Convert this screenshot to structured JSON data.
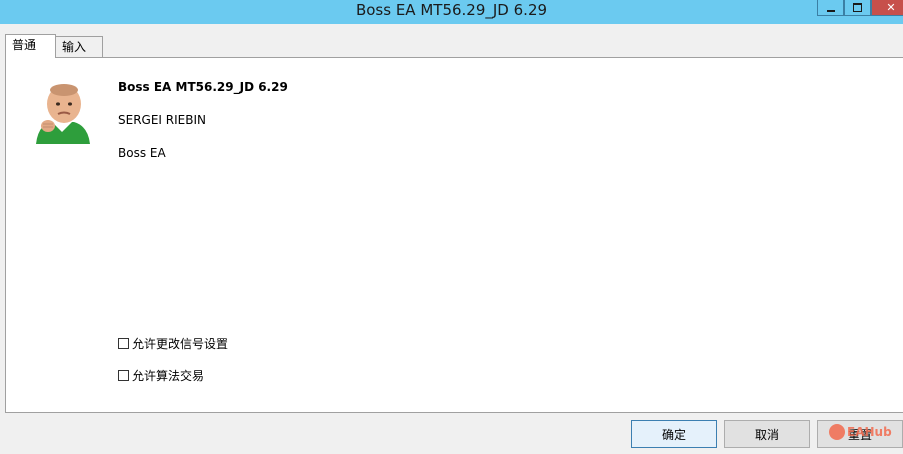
{
  "window": {
    "title": "Boss EA MT56.29_JD 6.29"
  },
  "tabs": [
    {
      "label": "普通"
    },
    {
      "label": "输入"
    }
  ],
  "general": {
    "ea_name": "Boss EA MT56.29_JD 6.29",
    "author": "SERGEI RIEBIN",
    "description": "Boss EA",
    "checkboxes": [
      {
        "label": "允许更改信号设置",
        "checked": false
      },
      {
        "label": "允许算法交易",
        "checked": false
      }
    ]
  },
  "buttons": {
    "ok": "确定",
    "cancel": "取消",
    "reset": "重置"
  },
  "watermark": "EAHub"
}
